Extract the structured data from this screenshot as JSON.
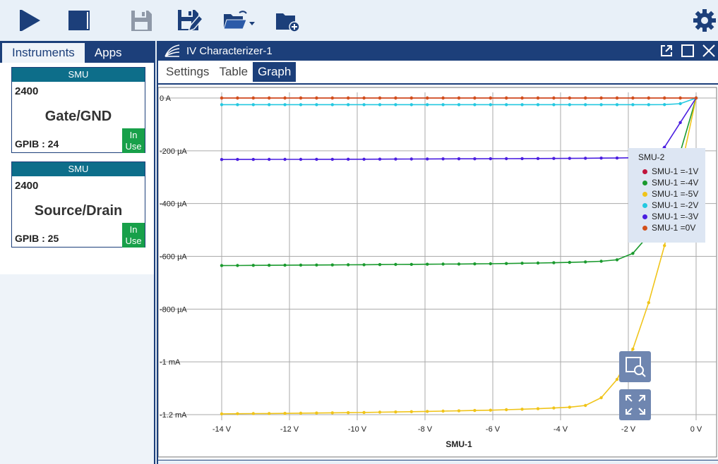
{
  "toolbar": {
    "buttons": [
      "play-icon",
      "stop-icon",
      "save-icon",
      "save-as-icon",
      "open-folder-icon",
      "new-folder-icon",
      "gear-icon"
    ]
  },
  "sidebar": {
    "tabs": [
      {
        "label": "Instruments",
        "active": true
      },
      {
        "label": "Apps",
        "active": false
      }
    ],
    "instruments": [
      {
        "type": "SMU",
        "model": "2400",
        "name": "Gate/GND",
        "address": "GPIB : 24",
        "status": "In Use"
      },
      {
        "type": "SMU",
        "model": "2400",
        "name": "Source/Drain",
        "address": "GPIB : 25",
        "status": "In Use"
      }
    ]
  },
  "panel": {
    "title": "IV Characterizer-1",
    "tabs": [
      {
        "label": "Settings",
        "active": false
      },
      {
        "label": "Table",
        "active": false
      },
      {
        "label": "Graph",
        "active": true
      }
    ]
  },
  "colors": {
    "primary": "#1c3f7a",
    "teal": "#0d6e8a",
    "status_green": "#18a04a"
  },
  "chart_data": {
    "type": "line",
    "xlabel": "SMU-1",
    "ylabel": "",
    "x_ticks": [
      "-14 V",
      "-12 V",
      "-10 V",
      "-8 V",
      "-6 V",
      "-4 V",
      "-2 V",
      "0 V"
    ],
    "y_ticks": [
      "0 A",
      "-200 µA",
      "-400 µA",
      "-600 µA",
      "-800 µA",
      "-1 mA",
      "-1.2 mA"
    ],
    "xlim": [
      -14,
      0
    ],
    "ylim": [
      -1.2,
      0
    ],
    "y_unit": "mA",
    "grid": true,
    "legend_title": "SMU-2",
    "legend_position": "top-right",
    "series": [
      {
        "name": "SMU-1 =-1V",
        "color": "#c0143c",
        "points": [
          [
            -14,
            0
          ],
          [
            -2,
            0
          ],
          [
            0,
            0
          ]
        ]
      },
      {
        "name": "SMU-1 =-4V",
        "color": "#1a9a2e",
        "points": [
          [
            -14,
            -0.635
          ],
          [
            -10,
            -0.632
          ],
          [
            -6,
            -0.628
          ],
          [
            -4,
            -0.624
          ],
          [
            -3,
            -0.62
          ],
          [
            -2.5,
            -0.617
          ],
          [
            -2,
            -0.605
          ],
          [
            -1.5,
            -0.545
          ],
          [
            -1,
            -0.42
          ],
          [
            -0.5,
            -0.22
          ],
          [
            0,
            0
          ]
        ]
      },
      {
        "name": "SMU-1 =-5V",
        "color": "#f0c419",
        "points": [
          [
            -14,
            -1.197
          ],
          [
            -12,
            -1.195
          ],
          [
            -10,
            -1.192
          ],
          [
            -8,
            -1.188
          ],
          [
            -6,
            -1.183
          ],
          [
            -4.5,
            -1.177
          ],
          [
            -3.5,
            -1.17
          ],
          [
            -3,
            -1.16
          ],
          [
            -2.5,
            -1.1
          ],
          [
            -2,
            -1.0
          ],
          [
            -1.5,
            -0.82
          ],
          [
            -1,
            -0.6
          ],
          [
            -0.5,
            -0.3
          ],
          [
            0,
            0
          ]
        ]
      },
      {
        "name": "SMU-1 =-2V",
        "color": "#22c8e0",
        "points": [
          [
            -14,
            -0.025
          ],
          [
            -4,
            -0.025
          ],
          [
            -1,
            -0.025
          ],
          [
            -0.5,
            -0.023
          ],
          [
            0,
            0
          ]
        ]
      },
      {
        "name": "SMU-1 =-3V",
        "color": "#4a1ee0",
        "points": [
          [
            -14,
            -0.233
          ],
          [
            -10,
            -0.232
          ],
          [
            -6,
            -0.23
          ],
          [
            -4,
            -0.229
          ],
          [
            -2,
            -0.227
          ],
          [
            -1.5,
            -0.225
          ],
          [
            -1,
            -0.2
          ],
          [
            -0.5,
            -0.1
          ],
          [
            0,
            0
          ]
        ]
      },
      {
        "name": "SMU-1 =0V",
        "color": "#d2501a",
        "points": [
          [
            -14,
            0
          ],
          [
            -2,
            0
          ],
          [
            0,
            0
          ]
        ]
      }
    ]
  }
}
